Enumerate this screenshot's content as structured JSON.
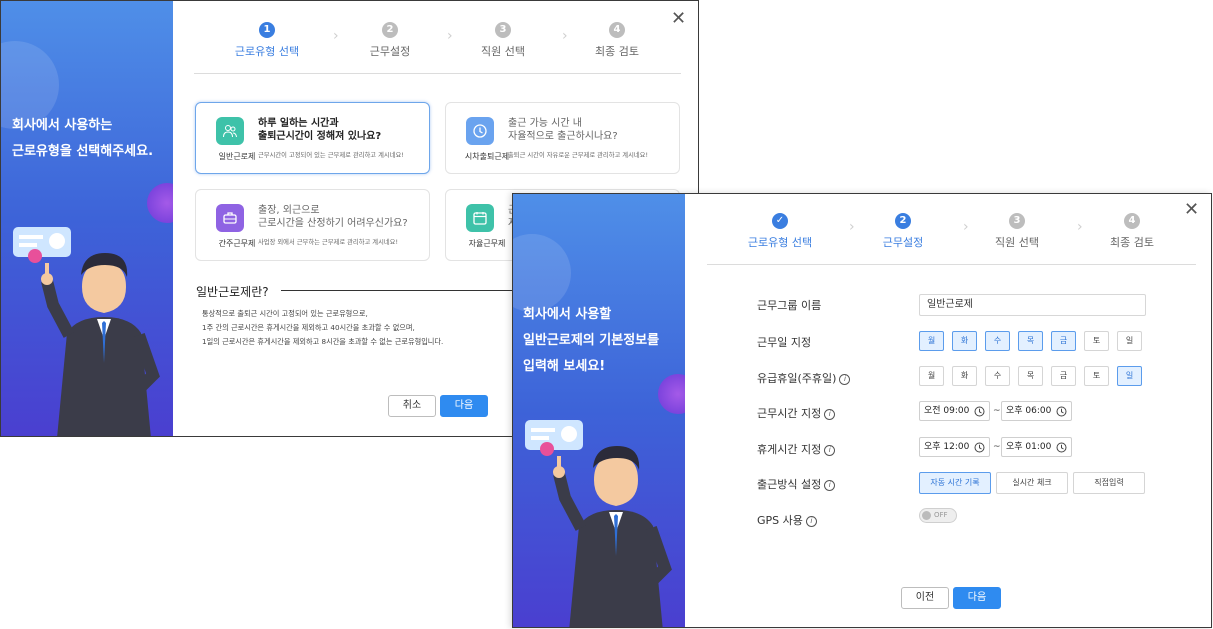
{
  "dialog1": {
    "sidebar_lines": [
      "회사에서 사용하는",
      "근로유형을 선택해주세요."
    ],
    "steps": [
      {
        "num": "1",
        "label": "근로유형 선택"
      },
      {
        "num": "2",
        "label": "근무설정"
      },
      {
        "num": "3",
        "label": "직원 선택"
      },
      {
        "num": "4",
        "label": "최종 검토"
      }
    ],
    "cards": [
      {
        "label": "일반근로제",
        "title_lines": [
          "하루 일하는 시간과",
          "출퇴근시간이 정해져 있나요?"
        ],
        "desc": "근무시간이 고정되어 있는 근무제로 관리하고 계시네요!",
        "color": "#3ec2a9"
      },
      {
        "label": "시차출퇴근제",
        "title_lines": [
          "출근 가능 시간 내",
          "자율적으로 출근하시나요?"
        ],
        "desc": "출퇴근 시간이 자유로운 근무제로 관리하고 계시네요!",
        "color": "#6aa3ef"
      },
      {
        "label": "간주근무제",
        "title_lines": [
          "출장, 외근으로",
          "근로시간을 산정하기 어려우신가요?"
        ],
        "desc": "사업장 외에서 근무하는 근무제로 관리하고 계시네요!",
        "color": "#8f63e3"
      },
      {
        "label": "자율근무제",
        "title_lines": [
          "근",
          "자"
        ],
        "desc": "",
        "color": "#3ec2a9"
      }
    ],
    "section_title": "일반근로제란?",
    "desc_lines": [
      "통상적으로 출퇴근 시간이 고정되어 있는 근로유형으로,",
      "1주 간의 근로시간은 휴게시간을 제외하고 40시간을 초과할 수 없으며,",
      "1일의 근로시간은 휴게시간을 제외하고 8시간을 초과할 수 없는 근로유형입니다."
    ],
    "cancel_label": "취소",
    "next_label": "다음"
  },
  "dialog2": {
    "sidebar_lines": [
      "회사에서 사용할",
      "일반근로제의 기본정보를",
      "입력해 보세요!"
    ],
    "steps": [
      {
        "num": "✓",
        "label": "근로유형 선택"
      },
      {
        "num": "2",
        "label": "근무설정"
      },
      {
        "num": "3",
        "label": "직원 선택"
      },
      {
        "num": "4",
        "label": "최종 검토"
      }
    ],
    "form": {
      "group_name_label": "근무그룹 이름",
      "group_name_value": "일반근로제",
      "workdays_label": "근무일 지정",
      "paid_holiday_label": "유급휴일(주휴일)",
      "days": [
        "월",
        "화",
        "수",
        "목",
        "금",
        "토",
        "일"
      ],
      "work_days_on": [
        true,
        true,
        true,
        true,
        true,
        false,
        false
      ],
      "holiday_on": [
        false,
        false,
        false,
        false,
        false,
        false,
        true
      ],
      "work_time_label": "근무시간 지정",
      "work_start": "오전 09:00",
      "work_end": "오후 06:00",
      "break_time_label": "휴게시간 지정",
      "break_start": "오후 12:00",
      "break_end": "오후 01:00",
      "tilde": "~",
      "checkin_label": "출근방식 설정",
      "checkin_options": [
        "자동 시간 기록",
        "실시간 체크",
        "직접입력"
      ],
      "checkin_selected": 0,
      "gps_label": "GPS 사용",
      "gps_state": "OFF"
    },
    "prev_label": "이전",
    "next_label": "다음"
  },
  "colors": {
    "accent": "#2f8bf0",
    "active_step": "#3a7ee0"
  }
}
